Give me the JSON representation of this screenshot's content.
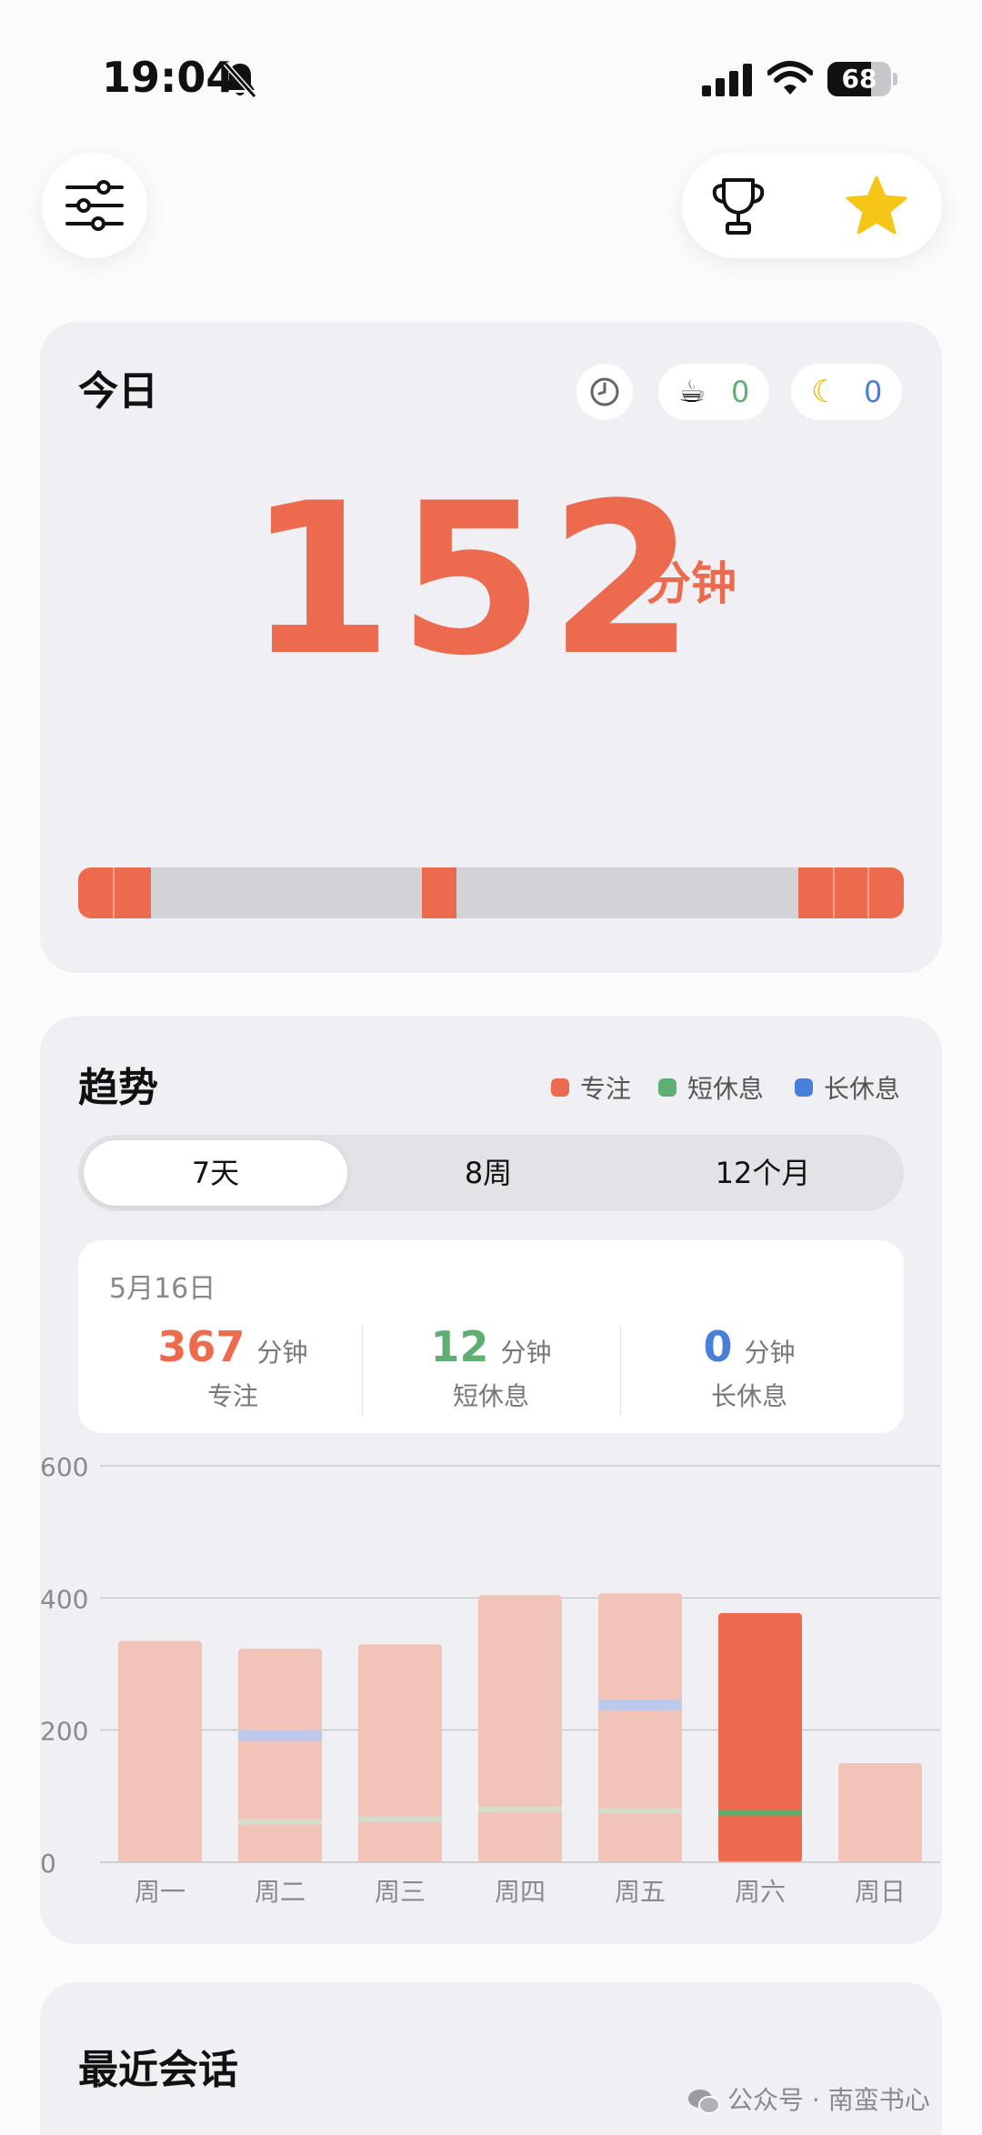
{
  "status": {
    "time": "19:04",
    "battery": "68",
    "battery_level": 0.68
  },
  "toolbar": {
    "filter_icon": "sliders-icon",
    "trophy_icon": "trophy-icon",
    "star_icon": "star-icon",
    "star_color": "#f5c518"
  },
  "today": {
    "title": "今日",
    "short_break_count": "0",
    "long_break_count": "0",
    "minutes": "152",
    "unit": "分钟",
    "accent": "#ec6a4e"
  },
  "trend": {
    "title": "趋势",
    "legend": {
      "focus": "专注",
      "short_break": "短休息",
      "long_break": "长休息"
    },
    "colors": {
      "focus": "#ec6a4e",
      "focus_light": "#f2c3b9",
      "short_break": "#5fae72",
      "long_break": "#4a7fd9"
    },
    "tabs": [
      "7天",
      "8周",
      "12个月"
    ],
    "active_tab": "7天",
    "summary": {
      "date": "5月16日",
      "focus_value": "367",
      "focus_unit": "分钟",
      "focus_label": "专注",
      "short_value": "12",
      "short_unit": "分钟",
      "short_label": "短休息",
      "long_value": "0",
      "long_unit": "分钟",
      "long_label": "长休息"
    }
  },
  "chart_data": {
    "type": "bar",
    "categories": [
      "周一",
      "周二",
      "周三",
      "周四",
      "周五",
      "周六",
      "周日"
    ],
    "series": [
      {
        "name": "专注",
        "values": [
          335,
          305,
          320,
          392,
          380,
          365,
          150
        ]
      },
      {
        "name": "短休息",
        "values": [
          0,
          3,
          10,
          12,
          12,
          12,
          0
        ]
      },
      {
        "name": "长休息",
        "values": [
          0,
          15,
          0,
          0,
          15,
          0,
          0
        ]
      }
    ],
    "highlighted_category": "周六",
    "yticks": [
      0,
      200,
      400,
      600
    ],
    "ylim": [
      0,
      600
    ],
    "grid": true
  },
  "recent": {
    "title": "最近会话"
  },
  "watermark": "公众号 · 南蛮书心"
}
